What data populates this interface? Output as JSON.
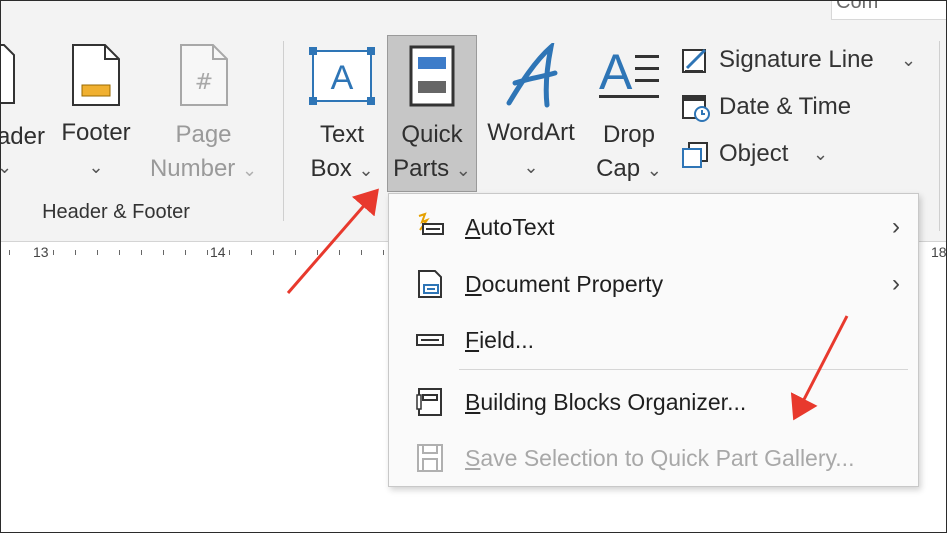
{
  "ribbon": {
    "top_chip_text": "Com",
    "buttons": {
      "header": {
        "label": "ader",
        "chevron": "⌄"
      },
      "footer": {
        "label": "Footer",
        "chevron": "⌄"
      },
      "page_number": {
        "label1": "Page",
        "label2": "Number",
        "chevron": "⌄"
      },
      "text_box": {
        "label1": "Text",
        "label2": "Box",
        "chevron": "⌄"
      },
      "quick_parts": {
        "label1": "Quick",
        "label2": "Parts",
        "chevron": "⌄"
      },
      "wordart": {
        "label": "WordArt",
        "chevron": "⌄"
      },
      "drop_cap": {
        "label1": "Drop",
        "label2": "Cap",
        "chevron": "⌄"
      }
    },
    "small_buttons": {
      "signature_line": {
        "label": "Signature Line",
        "chevron": "⌄"
      },
      "date_time": {
        "label": "Date & Time"
      },
      "object": {
        "label": "Object",
        "chevron": "⌄"
      }
    },
    "group_label": "Header & Footer"
  },
  "ruler": {
    "numbers": [
      "13",
      "14",
      "18"
    ]
  },
  "menu": {
    "items": [
      {
        "first": "A",
        "rest": "utoText",
        "submenu": true
      },
      {
        "first": "D",
        "rest": "ocument Property",
        "submenu": true
      },
      {
        "first": "F",
        "rest": "ield...",
        "submenu": false
      },
      {
        "first": "B",
        "rest": "uilding Blocks Organizer...",
        "submenu": false
      },
      {
        "first": "S",
        "rest": "ave Selection to Quick Part Gallery...",
        "submenu": false,
        "disabled": true
      }
    ],
    "submenu_arrow": "›"
  },
  "colors": {
    "accent_blue": "#2e75b6",
    "highlight": "#c6c6c6",
    "annotation_arrow": "#e8392d",
    "disabled_text": "#a8a8a8"
  }
}
